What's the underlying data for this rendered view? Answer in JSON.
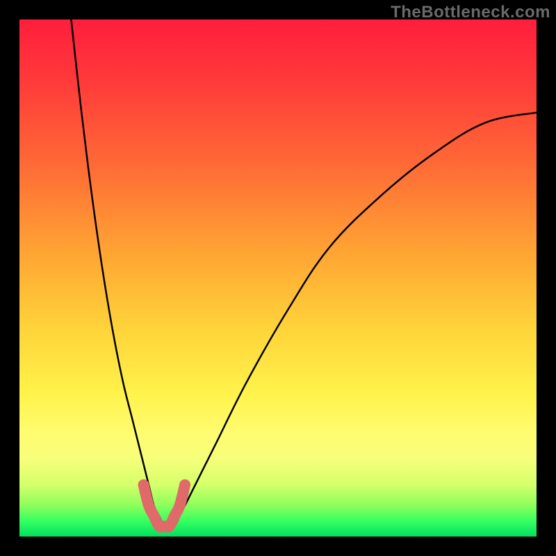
{
  "watermark": "TheBottleneck.com",
  "chart_data": {
    "type": "line",
    "title": "",
    "xlabel": "",
    "ylabel": "",
    "xlim": [
      0,
      100
    ],
    "ylim": [
      0,
      100
    ],
    "series": [
      {
        "name": "curve-black",
        "color": "#000000",
        "x": [
          10,
          12,
          14,
          16,
          18,
          20,
          22,
          24,
          25,
          26,
          27,
          28,
          29,
          30,
          31,
          32,
          34,
          38,
          44,
          52,
          60,
          70,
          80,
          90,
          100
        ],
        "values": [
          100,
          82,
          66,
          52,
          40,
          30,
          22,
          14,
          10,
          6,
          4,
          2,
          2,
          2,
          4,
          6,
          10,
          18,
          30,
          44,
          56,
          66,
          74,
          80,
          82
        ]
      },
      {
        "name": "highlight-pink",
        "color": "#e06a6a",
        "x": [
          24,
          25,
          26,
          27,
          28,
          29,
          30,
          31,
          32
        ],
        "values": [
          10,
          6,
          4,
          2,
          2,
          2,
          4,
          6,
          10
        ]
      }
    ]
  }
}
